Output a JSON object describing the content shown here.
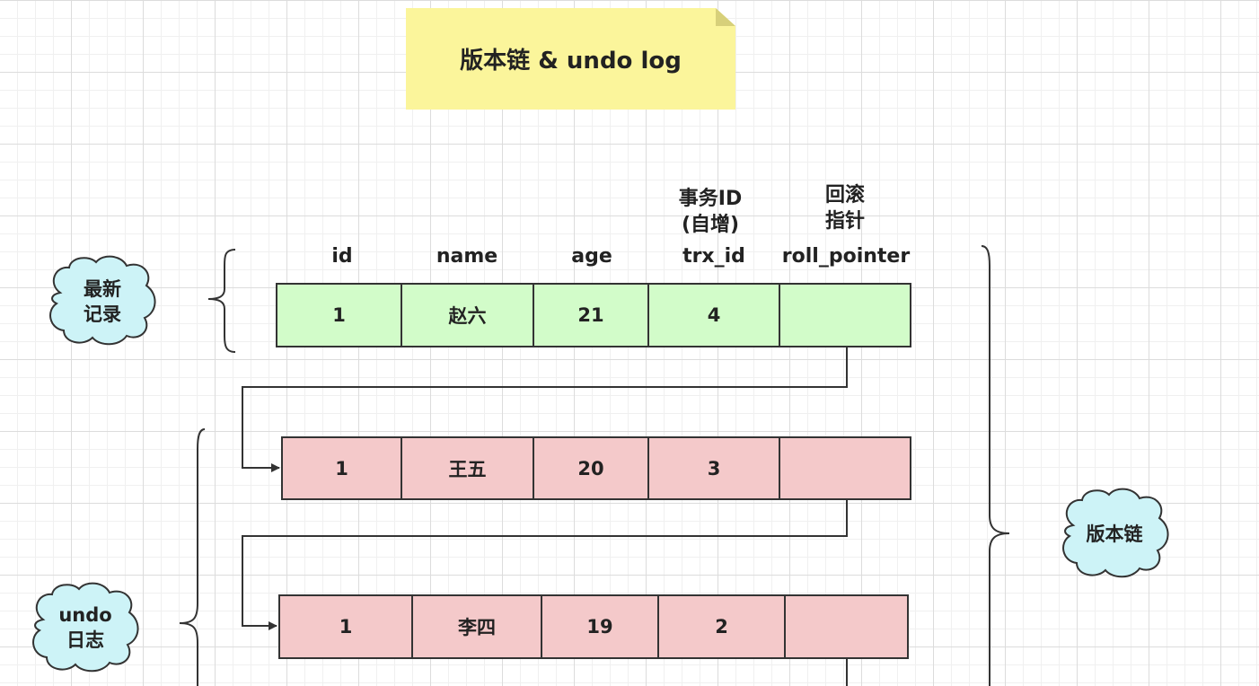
{
  "title": "版本链 & undo log",
  "columns": {
    "id": "id",
    "name": "name",
    "age": "age",
    "trx_id": "trx_id",
    "trx_id_note_line1": "事务ID",
    "trx_id_note_line2": "(自增)",
    "roll_pointer": "roll_pointer",
    "roll_pointer_note_line1": "回滚",
    "roll_pointer_note_line2": "指针"
  },
  "rows": [
    {
      "id": "1",
      "name": "赵六",
      "age": "21",
      "trx_id": "4",
      "roll_pointer": ""
    },
    {
      "id": "1",
      "name": "王五",
      "age": "20",
      "trx_id": "3",
      "roll_pointer": ""
    },
    {
      "id": "1",
      "name": "李四",
      "age": "19",
      "trx_id": "2",
      "roll_pointer": ""
    }
  ],
  "labels": {
    "latest_record": "最新\n记录",
    "undo_log": "undo\n日志",
    "version_chain": "版本链"
  },
  "colors": {
    "latest_row": "#d2fcc9",
    "undo_row": "#f4c9ca",
    "note": "#fbf59b",
    "cloud": "#cdf3f7"
  }
}
